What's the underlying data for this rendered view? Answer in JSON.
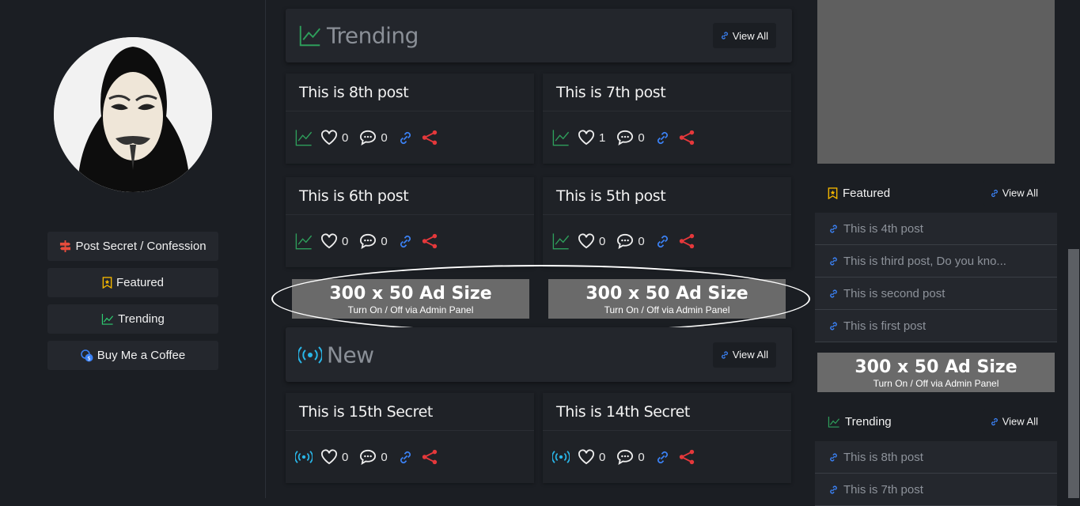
{
  "nav": {
    "items": [
      {
        "label": "Post Secret / Confession",
        "icon": "signpost-icon",
        "color": "#e74c3c"
      },
      {
        "label": "Featured",
        "icon": "bookmark-star-icon",
        "color": "#f0b400"
      },
      {
        "label": "Trending",
        "icon": "trending-icon",
        "color": "#2ecc71"
      },
      {
        "label": "Buy Me a Coffee",
        "icon": "coins-icon",
        "color": "#3b82f6"
      }
    ]
  },
  "trending": {
    "title": "Trending",
    "view_all": "View All",
    "posts": [
      {
        "title": "This is 8th post",
        "likes": "0",
        "comments": "0"
      },
      {
        "title": "This is 7th post",
        "likes": "1",
        "comments": "0"
      },
      {
        "title": "This is 6th post",
        "likes": "0",
        "comments": "0"
      },
      {
        "title": "This is 5th post",
        "likes": "0",
        "comments": "0"
      }
    ]
  },
  "ads": {
    "size_text": "300 x 50 Ad Size",
    "sub_text": "Turn On / Off via Admin Panel"
  },
  "new_section": {
    "title": "New",
    "view_all": "View All",
    "posts": [
      {
        "title": "This is 15th Secret",
        "likes": "0",
        "comments": "0"
      },
      {
        "title": "This is 14th Secret",
        "likes": "0",
        "comments": "0"
      }
    ]
  },
  "sidebar": {
    "featured": {
      "title": "Featured",
      "view_all": "View All",
      "items": [
        "This is 4th post",
        "This is third post, Do you kno...",
        "This is second post",
        "This is first post"
      ]
    },
    "trending": {
      "title": "Trending",
      "view_all": "View All",
      "items": [
        "This is 8th post",
        "This is 7th post"
      ]
    }
  },
  "colors": {
    "accent_green": "#2e9e5b",
    "accent_cyan": "#29b6e8",
    "share_red": "#e5383b",
    "link_blue": "#3b82f6"
  }
}
